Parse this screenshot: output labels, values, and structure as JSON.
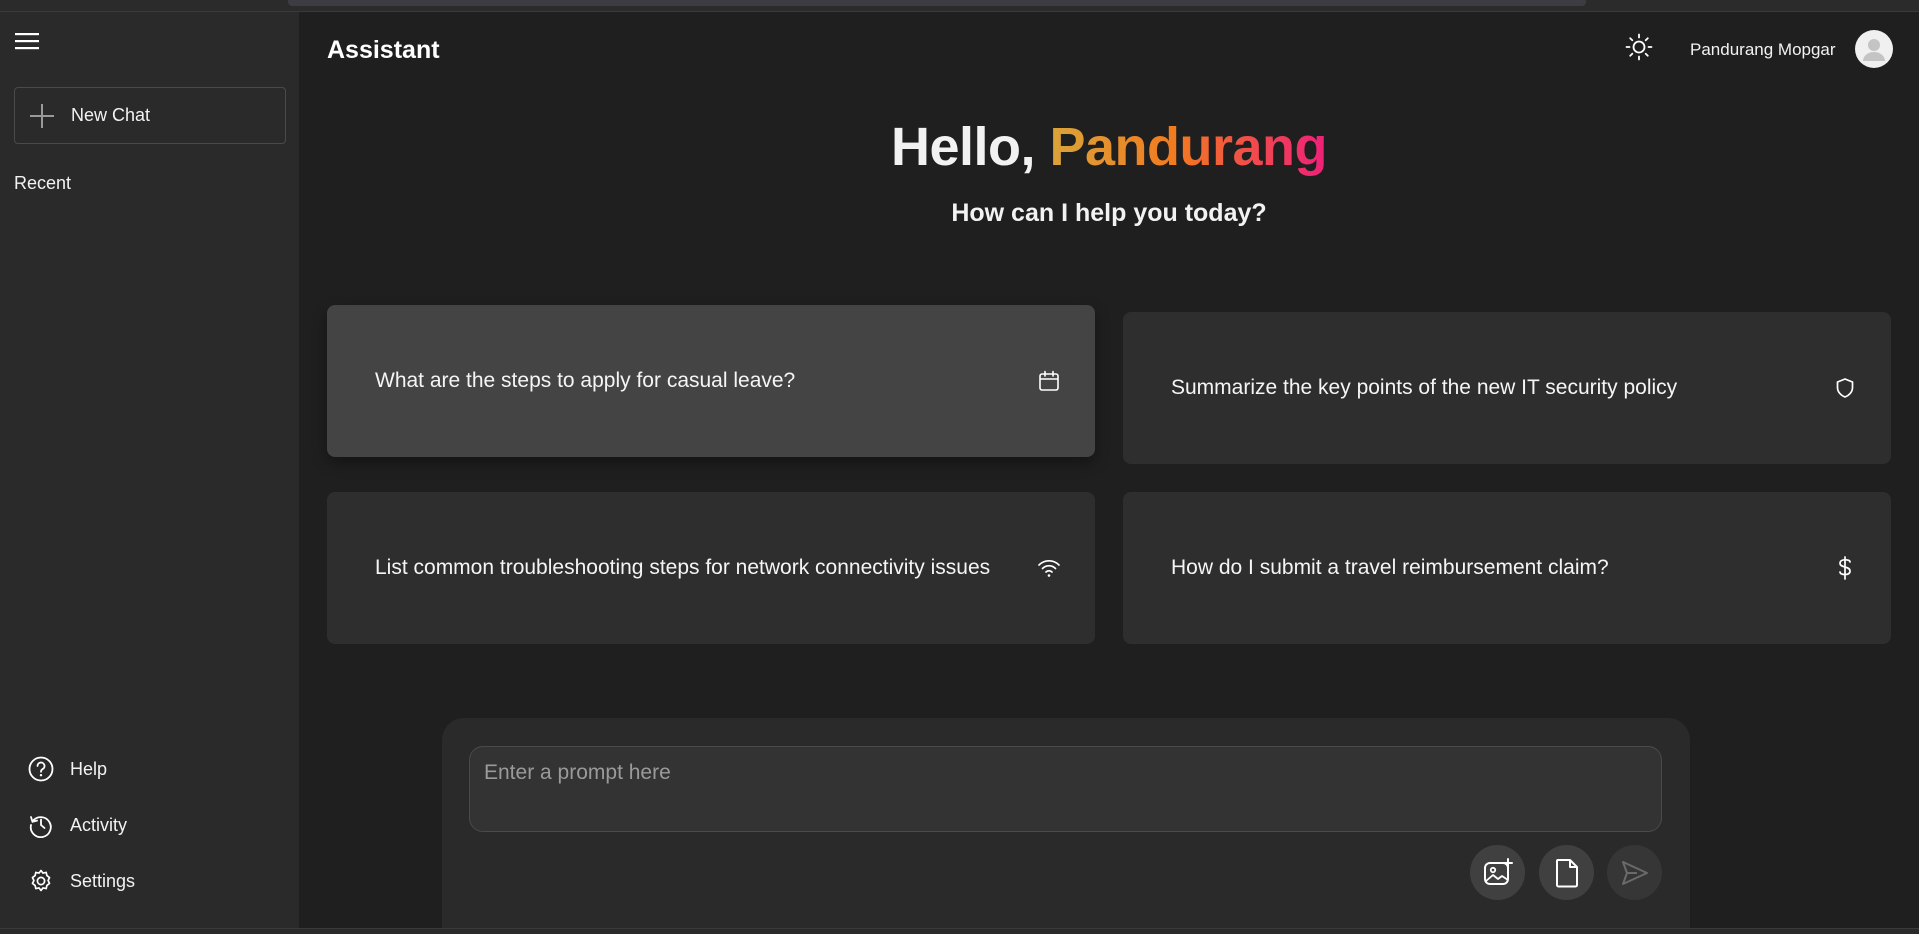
{
  "app": {
    "title": "Assistant"
  },
  "sidebar": {
    "new_chat_label": "New Chat",
    "recent_label": "Recent",
    "links": [
      {
        "label": "Help",
        "icon": "help-circle-icon"
      },
      {
        "label": "Activity",
        "icon": "history-icon"
      },
      {
        "label": "Settings",
        "icon": "gear-icon"
      }
    ]
  },
  "header": {
    "user_name": "Pandurang Mopgar",
    "theme_icon": "sun-icon"
  },
  "greeting": {
    "hello": "Hello, ",
    "name": "Pandurang",
    "subtitle": "How can I help you today?"
  },
  "suggestions": [
    {
      "text": "What are the steps to apply for casual leave?",
      "icon": "calendar-icon"
    },
    {
      "text": "Summarize the key points of the new IT security policy",
      "icon": "shield-icon"
    },
    {
      "text": "List common troubleshooting steps for network connectivity issues",
      "icon": "wifi-icon"
    },
    {
      "text": "How do I submit a travel reimbursement claim?",
      "icon": "dollar-icon"
    }
  ],
  "prompt": {
    "placeholder": "Enter a prompt here",
    "value": ""
  },
  "colors": {
    "background": "#1f1f1f",
    "sidebar": "#2a2a2a",
    "card": "#2e2e2e",
    "card_active": "#444444",
    "gradient_start": "#d9a43a",
    "gradient_mid": "#f27a1f",
    "gradient_end": "#ee1f7a"
  }
}
